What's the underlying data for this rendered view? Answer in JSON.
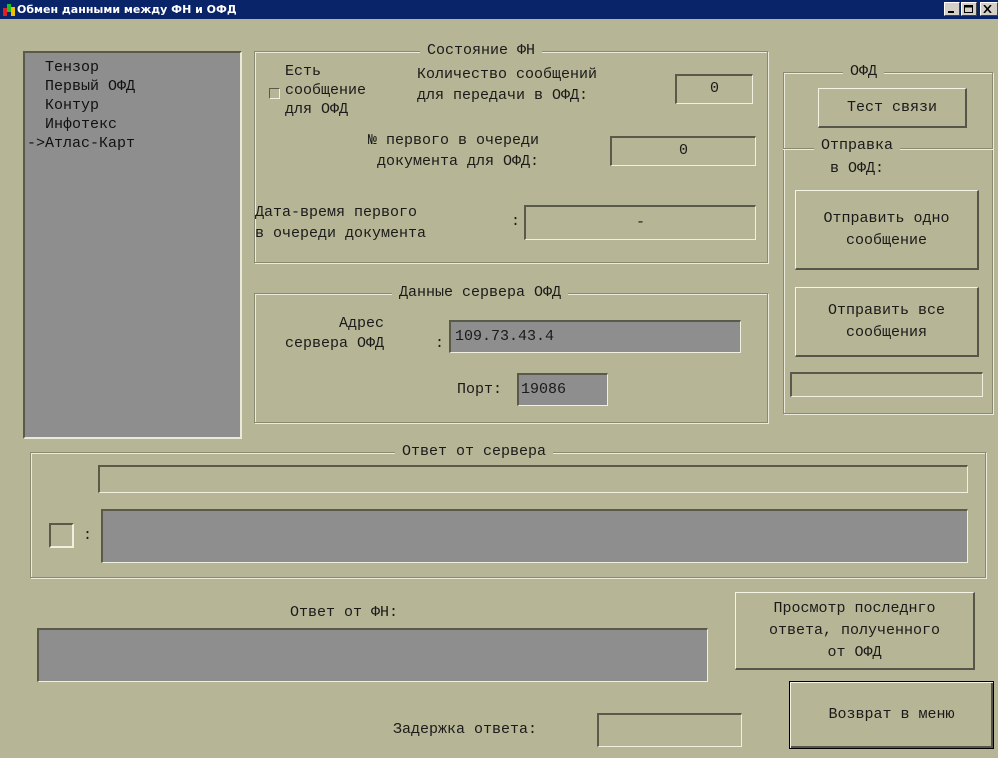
{
  "window": {
    "title": "Обмен данными между ФН и ОФД",
    "icon": "app-icon",
    "controls": [
      "minimize-icon",
      "maximize-icon",
      "close-icon"
    ]
  },
  "ofd_list": {
    "items": [
      "  Тензор",
      "  Первый ОФД",
      "  Контур",
      "  Инфотекс",
      "->Атлас-Карт"
    ]
  },
  "fn_state": {
    "title": "Состояние ФН",
    "has_message_label": "Есть\nсообщение\nдля ОФД",
    "count_label": "Количество сообщений\nдля передачи в ОФД:",
    "count_value": "0",
    "first_doc_label": "№ первого в очереди\nдокумента для ОФД:",
    "first_doc_value": "0",
    "datetime_label": "Дата-время первого\nв очереди документа",
    "datetime_colon": ":",
    "datetime_value": "-"
  },
  "server": {
    "title": "Данные сервера ОФД",
    "address_label": "Адрес\nсервера ОФД",
    "address_colon": ":",
    "address_value": "109.73.43.4",
    "port_label": "Порт:",
    "port_value": "19086"
  },
  "ofd_panel": {
    "title": "ОФД",
    "test_button": "Тест связи",
    "send_title": "Отправка\nв ОФД:",
    "send_one_button": "Отправить одно\nсообщение",
    "send_all_button": "Отправить все\nсообщения",
    "progress_value": ""
  },
  "server_response": {
    "title": "Ответ от сервера",
    "line_value": "",
    "colon": ":",
    "body_value": ""
  },
  "fn_response": {
    "label": "Ответ от ФН:",
    "value": ""
  },
  "view_last_button": "Просмотр последнго\nответа, полученного\nот ОФД",
  "back_button": "Возврат в меню",
  "delay": {
    "label": "Задержка ответа:",
    "value": ""
  }
}
